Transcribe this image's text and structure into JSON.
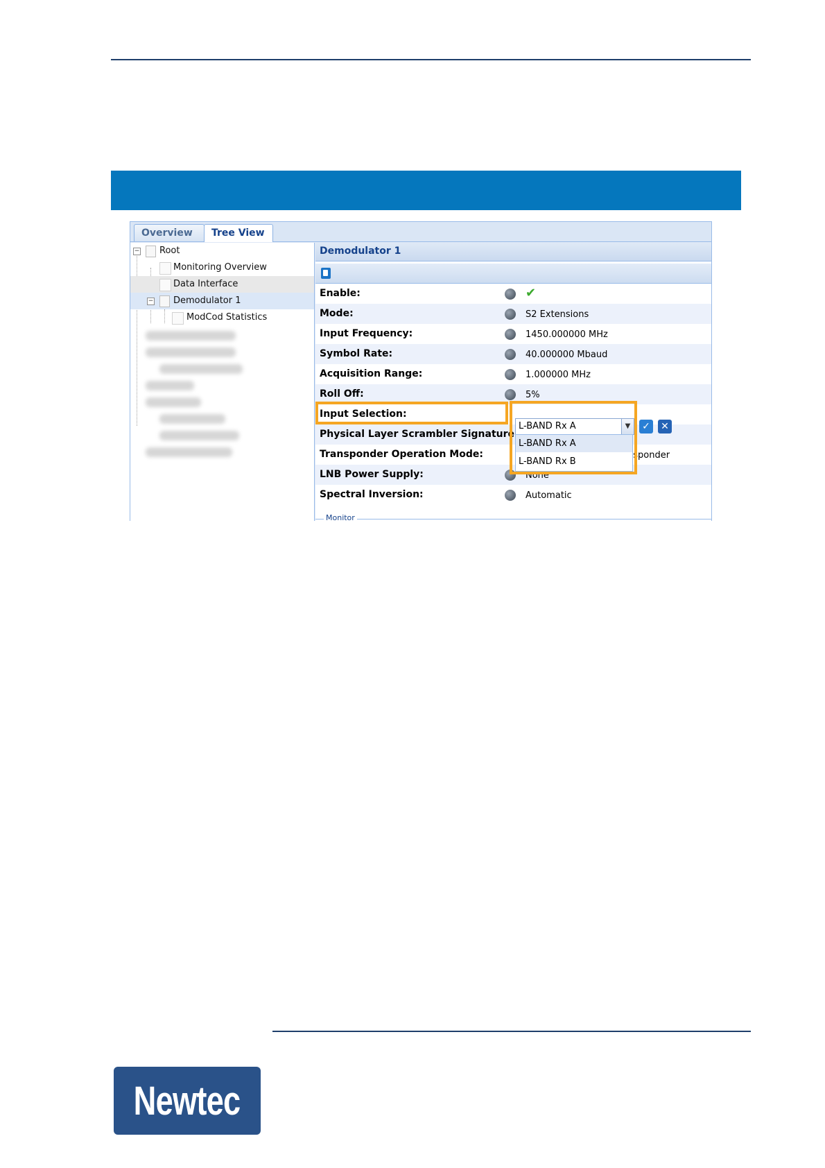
{
  "logo": {
    "text": "Newtec"
  },
  "tabs": [
    {
      "label": "Overview",
      "active": false
    },
    {
      "label": "Tree View",
      "active": true
    }
  ],
  "tree": {
    "items": [
      {
        "label": "Root"
      },
      {
        "label": "Monitoring Overview"
      },
      {
        "label": "Data Interface"
      },
      {
        "label": "Demodulator 1"
      },
      {
        "label": "ModCod Statistics"
      }
    ]
  },
  "panel": {
    "title": "Demodulator 1",
    "rows": [
      {
        "label": "Enable:",
        "value": "✔"
      },
      {
        "label": "Mode:",
        "value": "S2 Extensions"
      },
      {
        "label": "Input Frequency:",
        "value": "1450.000000 MHz"
      },
      {
        "label": "Symbol Rate:",
        "value": "40.000000 Mbaud"
      },
      {
        "label": "Acquisition Range:",
        "value": "1.000000 MHz"
      },
      {
        "label": "Roll Off:",
        "value": "5%"
      },
      {
        "label": "Input Selection:",
        "value": ""
      },
      {
        "label": "Physical Layer Scrambler Signature",
        "value": ""
      },
      {
        "label": "Transponder Operation Mode:",
        "value": "nsponder"
      },
      {
        "label": "LNB Power Supply:",
        "value": "None"
      },
      {
        "label": "Spectral Inversion:",
        "value": "Automatic"
      }
    ],
    "input_selection": {
      "current": "L-BAND Rx A",
      "options": [
        "L-BAND Rx A",
        "L-BAND Rx B"
      ]
    },
    "fieldset_legend": "Monitor"
  },
  "colors": {
    "band": "#0577bd",
    "highlight": "#f5a623",
    "logo_bg": "#2a5289"
  }
}
